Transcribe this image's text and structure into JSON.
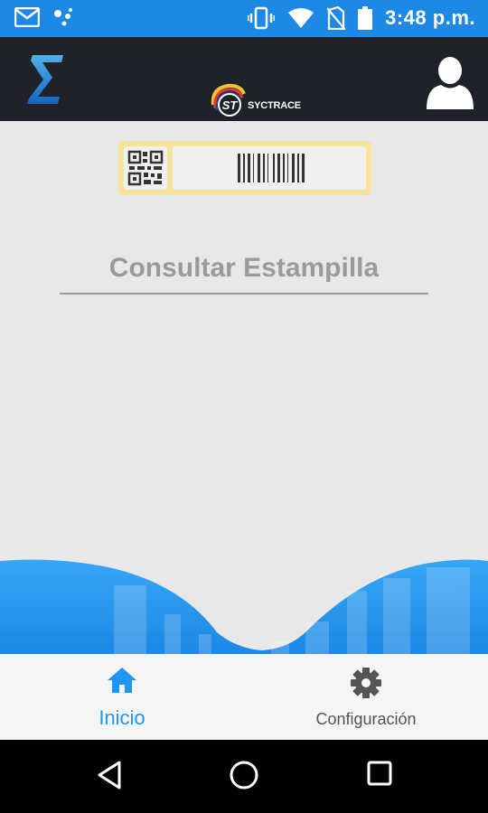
{
  "status_bar": {
    "time": "3:48 p.m.",
    "icons": [
      "gmail-icon",
      "assistant-dots-icon",
      "vibrate-icon",
      "wifi-icon",
      "no-sim-icon",
      "battery-icon"
    ]
  },
  "app_bar": {
    "left_icon": "sigma-icon",
    "logo_text": "SYCTRACE",
    "logo_badge": "ST",
    "right_icon": "profile-icon"
  },
  "main": {
    "scan_card_icons": [
      "qr-code-icon",
      "barcode-icon"
    ],
    "title": "Consultar Estampilla"
  },
  "bottom_nav": {
    "items": [
      {
        "label": "Inicio",
        "icon": "home-icon",
        "active": true
      },
      {
        "label": "Configuración",
        "icon": "gear-icon",
        "active": false
      }
    ]
  },
  "android_nav": {
    "buttons": [
      "back-icon",
      "home-circle-icon",
      "recents-icon"
    ]
  },
  "colors": {
    "status_bar": "#1e88e5",
    "app_bar": "#1f2228",
    "accent": "#2196f3",
    "card": "#f6e49b",
    "background": "#e8e8e8"
  }
}
